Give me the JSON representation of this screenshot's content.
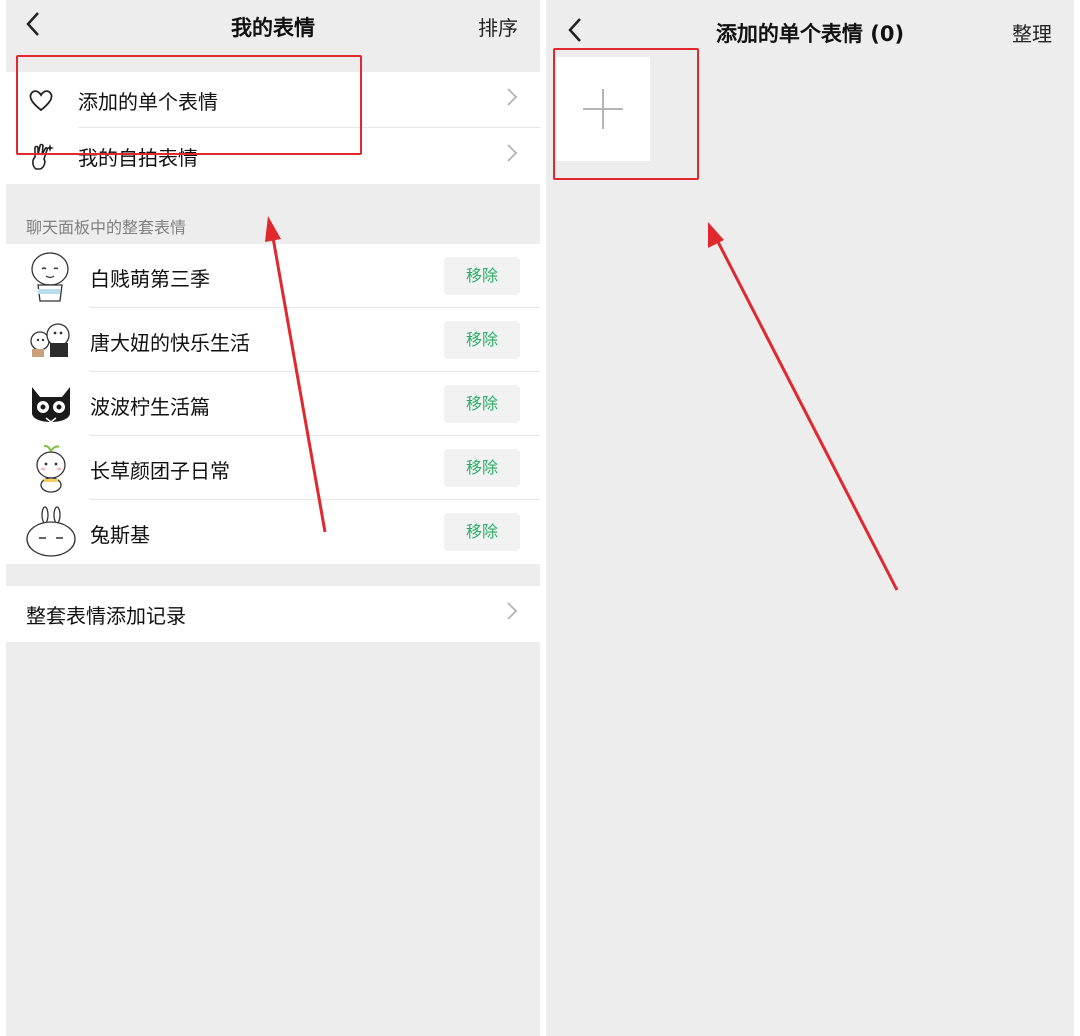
{
  "left_screen": {
    "title": "我的表情",
    "sort_label": "排序",
    "menu": [
      {
        "label": "添加的单个表情",
        "icon": "heart-outline-icon"
      },
      {
        "label": "我的自拍表情",
        "icon": "selfie-sparkle-icon"
      }
    ],
    "sticker_section_header": "聊天面板中的整套表情",
    "sticker_packs": [
      {
        "name": "白贱萌第三季",
        "action": "移除"
      },
      {
        "name": "唐大妞的快乐生活",
        "action": "移除"
      },
      {
        "name": "波波柠生活篇",
        "action": "移除"
      },
      {
        "name": "长草颜团子日常",
        "action": "移除"
      },
      {
        "name": "兔斯基",
        "action": "移除"
      }
    ],
    "history_label": "整套表情添加记录"
  },
  "right_screen": {
    "title": "添加的单个表情 (0)",
    "organize_label": "整理"
  },
  "colors": {
    "accent_green": "#2aae67",
    "annotation_red": "#e0282e",
    "background": "#ededed"
  }
}
